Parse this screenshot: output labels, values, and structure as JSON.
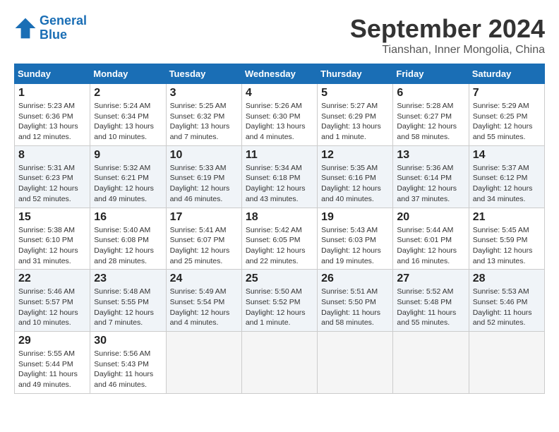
{
  "header": {
    "logo_line1": "General",
    "logo_line2": "Blue",
    "title": "September 2024",
    "subtitle": "Tianshan, Inner Mongolia, China"
  },
  "weekdays": [
    "Sunday",
    "Monday",
    "Tuesday",
    "Wednesday",
    "Thursday",
    "Friday",
    "Saturday"
  ],
  "weeks": [
    [
      {
        "day": "1",
        "sunrise": "Sunrise: 5:23 AM",
        "sunset": "Sunset: 6:36 PM",
        "daylight": "Daylight: 13 hours and 12 minutes."
      },
      {
        "day": "2",
        "sunrise": "Sunrise: 5:24 AM",
        "sunset": "Sunset: 6:34 PM",
        "daylight": "Daylight: 13 hours and 10 minutes."
      },
      {
        "day": "3",
        "sunrise": "Sunrise: 5:25 AM",
        "sunset": "Sunset: 6:32 PM",
        "daylight": "Daylight: 13 hours and 7 minutes."
      },
      {
        "day": "4",
        "sunrise": "Sunrise: 5:26 AM",
        "sunset": "Sunset: 6:30 PM",
        "daylight": "Daylight: 13 hours and 4 minutes."
      },
      {
        "day": "5",
        "sunrise": "Sunrise: 5:27 AM",
        "sunset": "Sunset: 6:29 PM",
        "daylight": "Daylight: 13 hours and 1 minute."
      },
      {
        "day": "6",
        "sunrise": "Sunrise: 5:28 AM",
        "sunset": "Sunset: 6:27 PM",
        "daylight": "Daylight: 12 hours and 58 minutes."
      },
      {
        "day": "7",
        "sunrise": "Sunrise: 5:29 AM",
        "sunset": "Sunset: 6:25 PM",
        "daylight": "Daylight: 12 hours and 55 minutes."
      }
    ],
    [
      {
        "day": "8",
        "sunrise": "Sunrise: 5:31 AM",
        "sunset": "Sunset: 6:23 PM",
        "daylight": "Daylight: 12 hours and 52 minutes."
      },
      {
        "day": "9",
        "sunrise": "Sunrise: 5:32 AM",
        "sunset": "Sunset: 6:21 PM",
        "daylight": "Daylight: 12 hours and 49 minutes."
      },
      {
        "day": "10",
        "sunrise": "Sunrise: 5:33 AM",
        "sunset": "Sunset: 6:19 PM",
        "daylight": "Daylight: 12 hours and 46 minutes."
      },
      {
        "day": "11",
        "sunrise": "Sunrise: 5:34 AM",
        "sunset": "Sunset: 6:18 PM",
        "daylight": "Daylight: 12 hours and 43 minutes."
      },
      {
        "day": "12",
        "sunrise": "Sunrise: 5:35 AM",
        "sunset": "Sunset: 6:16 PM",
        "daylight": "Daylight: 12 hours and 40 minutes."
      },
      {
        "day": "13",
        "sunrise": "Sunrise: 5:36 AM",
        "sunset": "Sunset: 6:14 PM",
        "daylight": "Daylight: 12 hours and 37 minutes."
      },
      {
        "day": "14",
        "sunrise": "Sunrise: 5:37 AM",
        "sunset": "Sunset: 6:12 PM",
        "daylight": "Daylight: 12 hours and 34 minutes."
      }
    ],
    [
      {
        "day": "15",
        "sunrise": "Sunrise: 5:38 AM",
        "sunset": "Sunset: 6:10 PM",
        "daylight": "Daylight: 12 hours and 31 minutes."
      },
      {
        "day": "16",
        "sunrise": "Sunrise: 5:40 AM",
        "sunset": "Sunset: 6:08 PM",
        "daylight": "Daylight: 12 hours and 28 minutes."
      },
      {
        "day": "17",
        "sunrise": "Sunrise: 5:41 AM",
        "sunset": "Sunset: 6:07 PM",
        "daylight": "Daylight: 12 hours and 25 minutes."
      },
      {
        "day": "18",
        "sunrise": "Sunrise: 5:42 AM",
        "sunset": "Sunset: 6:05 PM",
        "daylight": "Daylight: 12 hours and 22 minutes."
      },
      {
        "day": "19",
        "sunrise": "Sunrise: 5:43 AM",
        "sunset": "Sunset: 6:03 PM",
        "daylight": "Daylight: 12 hours and 19 minutes."
      },
      {
        "day": "20",
        "sunrise": "Sunrise: 5:44 AM",
        "sunset": "Sunset: 6:01 PM",
        "daylight": "Daylight: 12 hours and 16 minutes."
      },
      {
        "day": "21",
        "sunrise": "Sunrise: 5:45 AM",
        "sunset": "Sunset: 5:59 PM",
        "daylight": "Daylight: 12 hours and 13 minutes."
      }
    ],
    [
      {
        "day": "22",
        "sunrise": "Sunrise: 5:46 AM",
        "sunset": "Sunset: 5:57 PM",
        "daylight": "Daylight: 12 hours and 10 minutes."
      },
      {
        "day": "23",
        "sunrise": "Sunrise: 5:48 AM",
        "sunset": "Sunset: 5:55 PM",
        "daylight": "Daylight: 12 hours and 7 minutes."
      },
      {
        "day": "24",
        "sunrise": "Sunrise: 5:49 AM",
        "sunset": "Sunset: 5:54 PM",
        "daylight": "Daylight: 12 hours and 4 minutes."
      },
      {
        "day": "25",
        "sunrise": "Sunrise: 5:50 AM",
        "sunset": "Sunset: 5:52 PM",
        "daylight": "Daylight: 12 hours and 1 minute."
      },
      {
        "day": "26",
        "sunrise": "Sunrise: 5:51 AM",
        "sunset": "Sunset: 5:50 PM",
        "daylight": "Daylight: 11 hours and 58 minutes."
      },
      {
        "day": "27",
        "sunrise": "Sunrise: 5:52 AM",
        "sunset": "Sunset: 5:48 PM",
        "daylight": "Daylight: 11 hours and 55 minutes."
      },
      {
        "day": "28",
        "sunrise": "Sunrise: 5:53 AM",
        "sunset": "Sunset: 5:46 PM",
        "daylight": "Daylight: 11 hours and 52 minutes."
      }
    ],
    [
      {
        "day": "29",
        "sunrise": "Sunrise: 5:55 AM",
        "sunset": "Sunset: 5:44 PM",
        "daylight": "Daylight: 11 hours and 49 minutes."
      },
      {
        "day": "30",
        "sunrise": "Sunrise: 5:56 AM",
        "sunset": "Sunset: 5:43 PM",
        "daylight": "Daylight: 11 hours and 46 minutes."
      },
      null,
      null,
      null,
      null,
      null
    ]
  ]
}
